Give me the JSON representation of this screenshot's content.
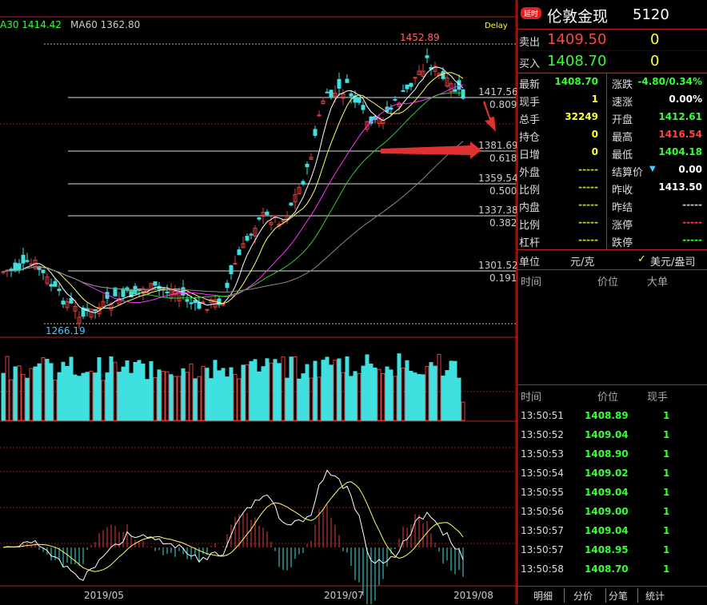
{
  "chart": {
    "ma30_label": "A30 1414.42",
    "ma60_label": "MA60 1362.80",
    "delay": "Delay",
    "high_label": "1452.89",
    "low_label": "1266.19",
    "fib": [
      {
        "price": "1417.56",
        "ratio": "0.809"
      },
      {
        "price": "1381.69",
        "ratio": "0.618"
      },
      {
        "price": "1359.54",
        "ratio": "0.500"
      },
      {
        "price": "1337.38",
        "ratio": "0.382"
      },
      {
        "price": "1301.52",
        "ratio": "0.191"
      }
    ],
    "x_labels": [
      "2019/05",
      "2019/07",
      "2019/08"
    ]
  },
  "header": {
    "tag": "延时",
    "name": "伦敦金现",
    "code": "5120"
  },
  "quote": {
    "sell_label": "卖出",
    "sell_price": "1409.50",
    "sell_vol": "0",
    "buy_label": "买入",
    "buy_price": "1408.70",
    "buy_vol": "0"
  },
  "stats": [
    {
      "label": "最新",
      "value": "1408.70",
      "color": "#3f3",
      "label2": "涨跌",
      "value2": "-4.80/0.34%",
      "color2": "#3f3"
    },
    {
      "label": "现手",
      "value": "1",
      "color": "#ff3",
      "label2": "速涨",
      "value2": "0.00%",
      "color2": "#fff"
    },
    {
      "label": "总手",
      "value": "32249",
      "color": "#ff3",
      "label2": "开盘",
      "value2": "1412.61",
      "color2": "#3f3"
    },
    {
      "label": "持仓",
      "value": "0",
      "color": "#ff3",
      "label2": "最高",
      "value2": "1416.54",
      "color2": "#f44"
    },
    {
      "label": "日增",
      "value": "0",
      "color": "#ff3",
      "label2": "最低",
      "value2": "1404.18",
      "color2": "#3f3"
    },
    {
      "label": "外盘",
      "value": "-----",
      "color": "#cc3",
      "label2": "结算价",
      "value2": "0.00",
      "color2": "#fff"
    },
    {
      "label": "比例",
      "value": "-----",
      "color": "#cc3",
      "label2": "昨收",
      "value2": "1413.50",
      "color2": "#fff"
    },
    {
      "label": "内盘",
      "value": "-----",
      "color": "#cc3",
      "label2": "昨结",
      "value2": "-----",
      "color2": "#ccc"
    },
    {
      "label": "比例",
      "value": "-----",
      "color": "#cc3",
      "label2": "涨停",
      "value2": "-----",
      "color2": "#f44"
    },
    {
      "label": "杠杆",
      "value": "-----",
      "color": "#cc3",
      "label2": "跌停",
      "value2": "-----",
      "color2": "#3f3"
    }
  ],
  "unit": {
    "label": "单位",
    "value": "元/克",
    "alt": "美元/盎司"
  },
  "bigorder": {
    "h1": "时间",
    "h2": "价位",
    "h3": "大单"
  },
  "ticks": {
    "h1": "时间",
    "h2": "价位",
    "h3": "现手",
    "rows": [
      {
        "time": "13:50:51",
        "price": "1408.89",
        "vol": "1"
      },
      {
        "time": "13:50:52",
        "price": "1409.04",
        "vol": "1"
      },
      {
        "time": "13:50:53",
        "price": "1408.90",
        "vol": "1"
      },
      {
        "time": "13:50:54",
        "price": "1409.02",
        "vol": "1"
      },
      {
        "time": "13:50:55",
        "price": "1409.04",
        "vol": "1"
      },
      {
        "time": "13:50:56",
        "price": "1409.00",
        "vol": "1"
      },
      {
        "time": "13:50:57",
        "price": "1409.04",
        "vol": "1"
      },
      {
        "time": "13:50:57",
        "price": "1408.95",
        "vol": "1"
      },
      {
        "time": "13:50:58",
        "price": "1408.70",
        "vol": "1"
      }
    ]
  },
  "tabs": [
    "明细",
    "分价",
    "分笔",
    "统计"
  ],
  "colors": {
    "up": "#e04040",
    "down": "#40e0e0",
    "grid": "#b22222"
  }
}
